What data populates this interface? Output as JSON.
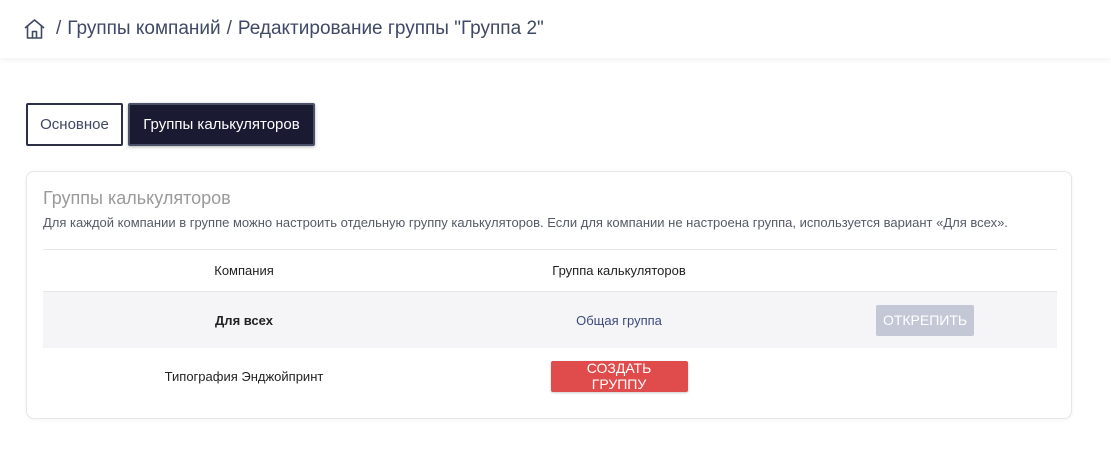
{
  "breadcrumb": {
    "home_icon": "home-icon",
    "separator": "/",
    "items": [
      "Группы компаний",
      "Редактирование группы \"Группа 2\""
    ]
  },
  "tabs": [
    {
      "label": "Основное",
      "active": false
    },
    {
      "label": "Группы калькуляторов",
      "active": true
    }
  ],
  "card": {
    "title": "Группы калькуляторов",
    "description": "Для каждой компании в группе можно настроить отдельную группу калькуляторов. Если для компании не настроена группа, используется вариант «Для всех».",
    "table": {
      "headers": [
        "Компания",
        "Группа калькуляторов",
        ""
      ],
      "rows": [
        {
          "company": "Для всех",
          "group": "Общая группа",
          "action": "ОТКРЕПИТЬ"
        },
        {
          "company": "Типография Энджойпринт",
          "group": "",
          "action": "СОЗДАТЬ ГРУППУ"
        }
      ]
    }
  },
  "colors": {
    "active_tab_bg": "#1a1b33",
    "danger": "#e04b4b",
    "disabled": "#c4c8d6",
    "link": "#3c4a7a"
  }
}
